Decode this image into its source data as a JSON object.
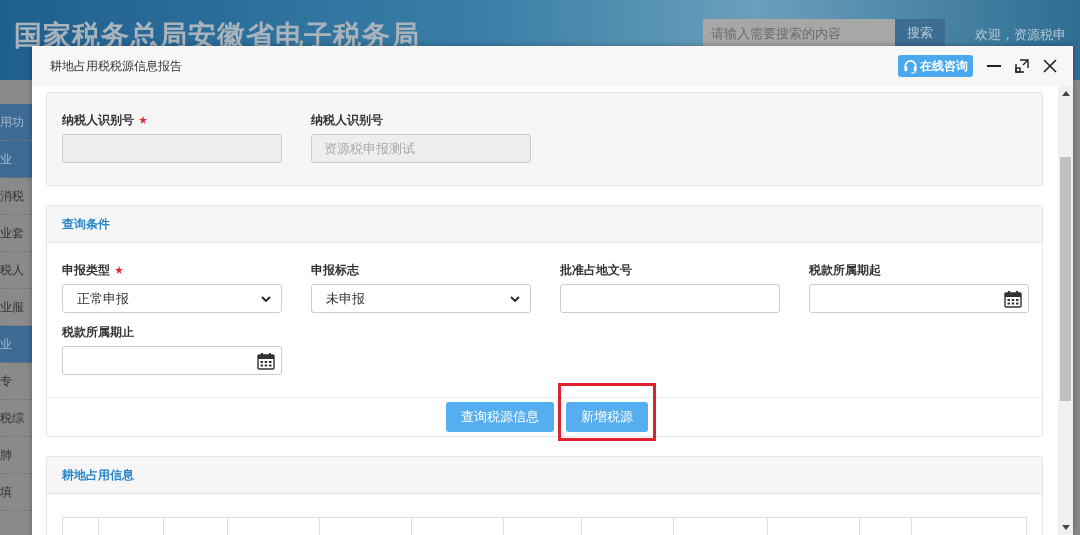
{
  "site_header": {
    "title": "国家税务总局安徽省电子税务局",
    "search": {
      "placeholder": "请输入需要搜索的内容",
      "button": "搜索"
    },
    "welcome": "欢迎，资源税申"
  },
  "sidebar": {
    "items": [
      {
        "label": "用功",
        "kind": "heading"
      },
      {
        "label": "业",
        "kind": "heading"
      },
      {
        "label": "消税",
        "kind": "link"
      },
      {
        "label": "业套",
        "kind": "link"
      },
      {
        "label": "税人",
        "kind": "link"
      },
      {
        "label": "业服",
        "kind": "link"
      },
      {
        "label": "业",
        "kind": "heading"
      },
      {
        "label": "专",
        "kind": "link"
      },
      {
        "label": "税综",
        "kind": "link"
      },
      {
        "label": "肺",
        "kind": "link"
      },
      {
        "label": "填",
        "kind": "link"
      }
    ]
  },
  "dialog": {
    "title": "耕地占用税税源信息报告",
    "consult_button": "在线咨询",
    "taxpayer_section": {
      "fields": [
        {
          "label": "纳税人识别号",
          "required": true,
          "disabled": true
        },
        {
          "label": "纳税人识别号",
          "required": false,
          "disabled": true,
          "placeholder": "资源税申报测试"
        }
      ]
    },
    "query_section": {
      "title": "查询条件",
      "fields": [
        {
          "label": "申报类型",
          "required": true,
          "kind": "select",
          "disabled": false,
          "value": "正常申报"
        },
        {
          "label": "申报标志",
          "required": false,
          "kind": "select",
          "disabled": false,
          "value": "未申报"
        },
        {
          "label": "批准占地文号",
          "required": false,
          "kind": "text",
          "disabled": false
        },
        {
          "label": "税款所属期起",
          "required": false,
          "kind": "date",
          "disabled": false
        },
        {
          "label": "税款所属期止",
          "required": false,
          "kind": "date",
          "disabled": false
        }
      ],
      "buttons": [
        {
          "label": "查询税源信息",
          "highlighted": false
        },
        {
          "label": "新增税源",
          "highlighted": true
        }
      ]
    },
    "occupation_section": {
      "title": "耕地占用信息"
    }
  }
}
